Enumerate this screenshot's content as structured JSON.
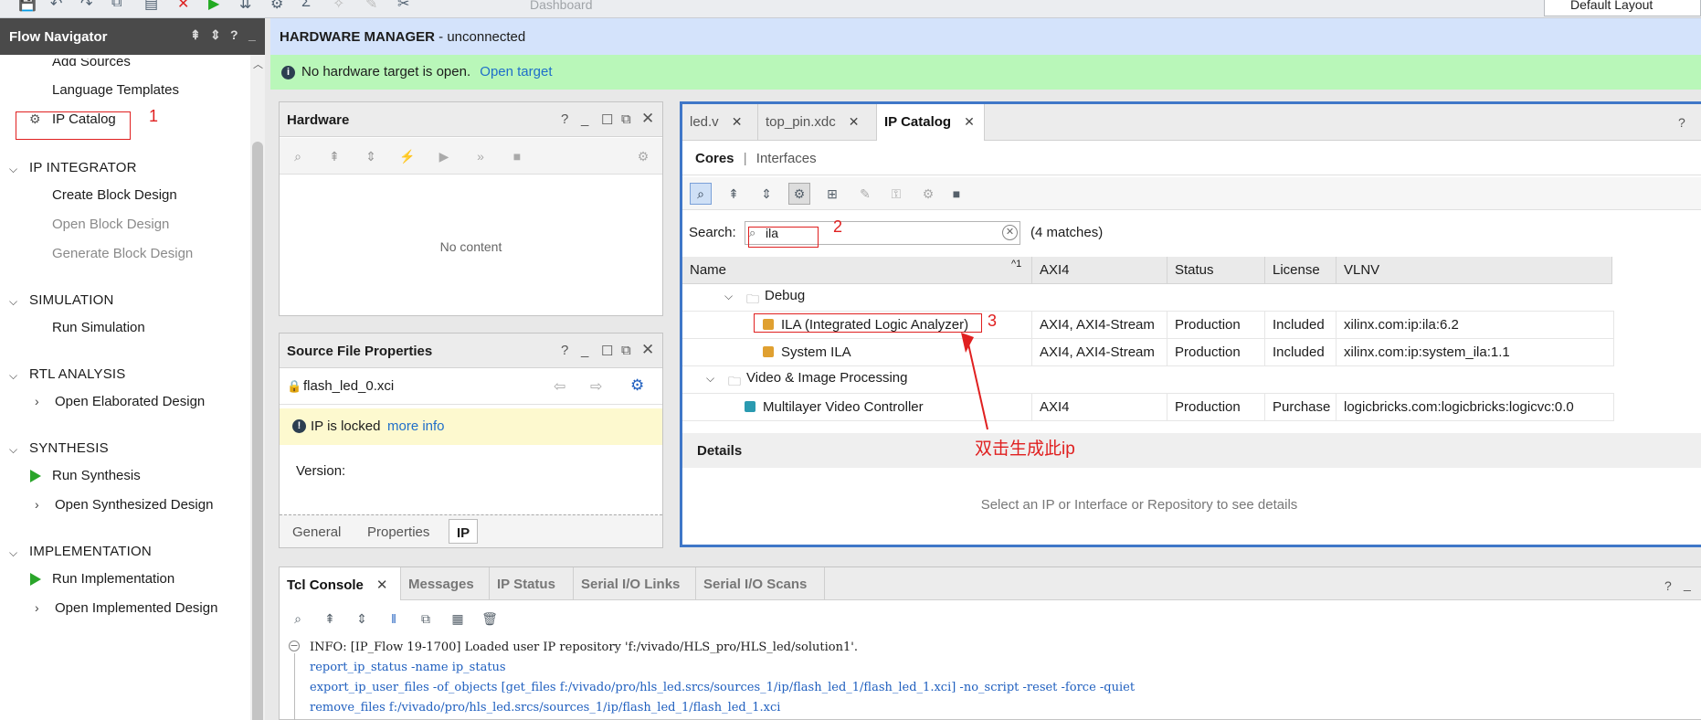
{
  "toolbar": {
    "dashboard_label": "Dashboard",
    "layout_value": "Default Layout"
  },
  "flow_navigator": {
    "title": "Flow Navigator",
    "project_manager_items": [
      "Add Sources",
      "Language Templates",
      "IP Catalog"
    ],
    "sections": [
      {
        "title": "IP INTEGRATOR",
        "items": [
          "Create Block Design",
          "Open Block Design",
          "Generate Block Design"
        ]
      },
      {
        "title": "SIMULATION",
        "items": [
          "Run Simulation"
        ]
      },
      {
        "title": "RTL ANALYSIS",
        "items": [
          "Open Elaborated Design"
        ]
      },
      {
        "title": "SYNTHESIS",
        "items": [
          "Run Synthesis",
          "Open Synthesized Design"
        ]
      },
      {
        "title": "IMPLEMENTATION",
        "items": [
          "Run Implementation",
          "Open Implemented Design"
        ]
      }
    ]
  },
  "hardware_manager": {
    "title": "HARDWARE MANAGER",
    "status": " - unconnected",
    "banner_text": "No hardware target is open.",
    "banner_link": "Open target"
  },
  "hardware_panel": {
    "title": "Hardware",
    "empty_text": "No content"
  },
  "source_props": {
    "title": "Source File Properties",
    "file": "flash_led_0.xci",
    "locked_text": "IP is locked",
    "locked_link": "more info",
    "version_label": "Version:",
    "tabs": [
      "General",
      "Properties",
      "IP"
    ]
  },
  "editor_tabs": [
    "led.v",
    "top_pin.xdc",
    "IP Catalog"
  ],
  "ip_catalog": {
    "view_tabs": [
      "Cores",
      "Interfaces"
    ],
    "search_label": "Search:",
    "search_value": "ila",
    "match_count": "(4 matches)",
    "columns": [
      "Name",
      "AXI4",
      "Status",
      "License",
      "VLNV"
    ],
    "sort_indicator": "1",
    "groups": [
      "Debug",
      "Video & Image Processing"
    ],
    "rows": [
      {
        "name": "ILA (Integrated Logic Analyzer)",
        "axi4": "AXI4, AXI4-Stream",
        "status": "Production",
        "license": "Included",
        "vlnv": "xilinx.com:ip:ila:6.2"
      },
      {
        "name": "System ILA",
        "axi4": "AXI4, AXI4-Stream",
        "status": "Production",
        "license": "Included",
        "vlnv": "xilinx.com:ip:system_ila:1.1"
      },
      {
        "name": "Multilayer Video Controller",
        "axi4": "AXI4",
        "status": "Production",
        "license": "Purchase",
        "vlnv": "logicbricks.com:logicbricks:logicvc:0.0"
      }
    ],
    "details_title": "Details",
    "details_empty": "Select an IP or Interface or Repository to see details"
  },
  "annotations": {
    "n1": "1",
    "n2": "2",
    "n3": "3",
    "note": "双击生成此ip"
  },
  "tcl": {
    "tabs": [
      "Tcl Console",
      "Messages",
      "IP Status",
      "Serial I/O Links",
      "Serial I/O Scans"
    ],
    "lines": [
      "INFO: [IP_Flow 19-1700] Loaded user IP repository 'f:/vivado/HLS_pro/HLS_led/solution1'.",
      "report_ip_status -name ip_status",
      "export_ip_user_files -of_objects  [get_files f:/vivado/pro/hls_led.srcs/sources_1/ip/flash_led_1/flash_led_1.xci] -no_script -reset -force -quiet",
      "remove_files  f:/vivado/pro/hls_led.srcs/sources_1/ip/flash_led_1/flash_led_1.xci"
    ]
  },
  "colors": {
    "accent": "#3f77c8",
    "banner": "#b9f7b9",
    "header": "#d4e3fb",
    "annotation": "#e02020",
    "link": "#1f6ec9"
  }
}
